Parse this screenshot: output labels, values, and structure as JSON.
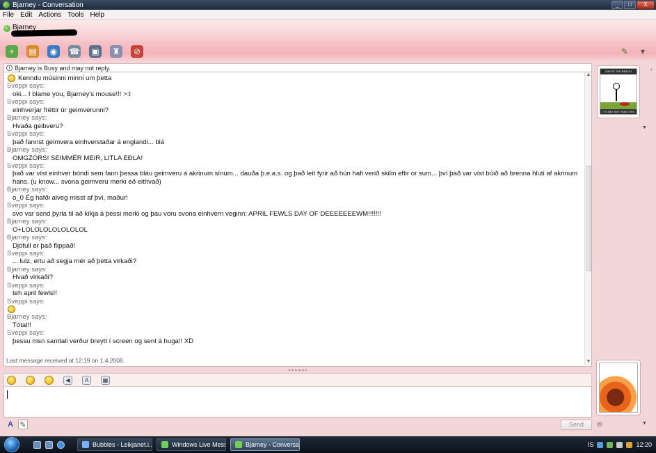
{
  "window": {
    "title": "Bjarney - Conversation",
    "buttons": {
      "minimize": "_",
      "maximize": "□",
      "close": "X"
    }
  },
  "menu": [
    "File",
    "Edit",
    "Actions",
    "Tools",
    "Help"
  ],
  "contact": {
    "name": "Bjarney"
  },
  "toolbar": {
    "icons": [
      "invite-icon",
      "share-files-icon",
      "video-call-icon",
      "call-icon",
      "activities-icon",
      "games-icon",
      "block-icon"
    ],
    "right_icons": [
      "paint-brush-icon",
      "show-menu-icon"
    ]
  },
  "status_banner": "Bjarney is Busy and may not reply.",
  "messages": [
    {
      "type": "emoticon-msg",
      "text": "Kenndu músinni minni um þetta"
    },
    {
      "type": "sender",
      "text": "Sveppi says:"
    },
    {
      "type": "msg",
      "text": "oki... I blame you, Bjarney's mouse!!! >:I"
    },
    {
      "type": "sender",
      "text": "Sveppi says:"
    },
    {
      "type": "msg",
      "text": "einhverjar fréttir úr geimverunni?"
    },
    {
      "type": "sender",
      "text": "Bjarney says:"
    },
    {
      "type": "msg",
      "text": "Hvaða geibveru?"
    },
    {
      "type": "sender",
      "text": "Sveppi says:"
    },
    {
      "type": "msg",
      "text": "það fannst geimvera einhverstaðar á englandi... blá"
    },
    {
      "type": "sender",
      "text": "Bjarney says:"
    },
    {
      "type": "msg",
      "text": "OMGZORS! SEIMMÉR MEIR, LITLA EÐLA!"
    },
    {
      "type": "sender",
      "text": "Sveppi says:"
    },
    {
      "type": "msg",
      "text": "það var víst einhver bóndi sem fann þessa bláu geimveru á akrinum sínum... dauða þ.e.a.s. og það leit fyrir að hún hafi verið skilin eftir or sum... því það var víst búið að brenna hluti af akrinum hans. (u know... svona geimveru merki eð eithvað)"
    },
    {
      "type": "sender",
      "text": "Bjarney says:"
    },
    {
      "type": "msg",
      "text": "o_0 Ég hafði alveg misst af því, maður!"
    },
    {
      "type": "sender",
      "text": "Sveppi says:"
    },
    {
      "type": "msg",
      "text": "svo var send þyrla til að kíkja á þessi merki og þau voru svona einhvern veginn: APRIL FEWLS DAY OF DEEEEEEEWM!!!!!!!"
    },
    {
      "type": "sender",
      "text": "Bjarney says:"
    },
    {
      "type": "msg",
      "text": "O+LOLOLOLOLOLOLOL"
    },
    {
      "type": "sender",
      "text": "Bjarney says:"
    },
    {
      "type": "msg",
      "text": "Djöfull er það flippað!"
    },
    {
      "type": "sender",
      "text": "Sveppi says:"
    },
    {
      "type": "msg",
      "text": "... lulz, ertu að segja mér að þetta virkaði?"
    },
    {
      "type": "sender",
      "text": "Bjarney says:"
    },
    {
      "type": "msg",
      "text": "Hvað virkaði?"
    },
    {
      "type": "sender",
      "text": "Sveppi says:"
    },
    {
      "type": "msg",
      "text": "teh april fewls!!"
    },
    {
      "type": "sender",
      "text": "Sveppi says:"
    },
    {
      "type": "emoticon-only",
      "text": ""
    },
    {
      "type": "sender",
      "text": "Bjarney says:"
    },
    {
      "type": "msg",
      "text": "Tótal!!"
    },
    {
      "type": "sender",
      "text": "Sveppi says:"
    },
    {
      "type": "msg",
      "text": "þessu msn samtali verður breytt í screen og sent á huga!! XD"
    }
  ],
  "last_received": "Last message received at 12:19 on 1.4.2008.",
  "compose": {
    "toolbar_icons": [
      "emoticon-icon",
      "wink-icon",
      "nudge-icon",
      "voice-clip-icon",
      "font-icon",
      "background-icon"
    ],
    "send_label": "Send",
    "format_icons": {
      "font": "A",
      "handwriting": "✎"
    }
  },
  "contact_avatar": {
    "top_band": "DAY AT THE BEACH",
    "bottom_band": "IT'S BETTER THAN THIS"
  },
  "taskbar": {
    "tasks": [
      {
        "label": "Bubbles - Leikjanet.i...",
        "active": false
      },
      {
        "label": "Windows Live Mess...",
        "active": false
      },
      {
        "label": "Bjarney - Conversati...",
        "active": true
      }
    ],
    "tray": {
      "language": "IS",
      "clock": "12:20"
    }
  }
}
